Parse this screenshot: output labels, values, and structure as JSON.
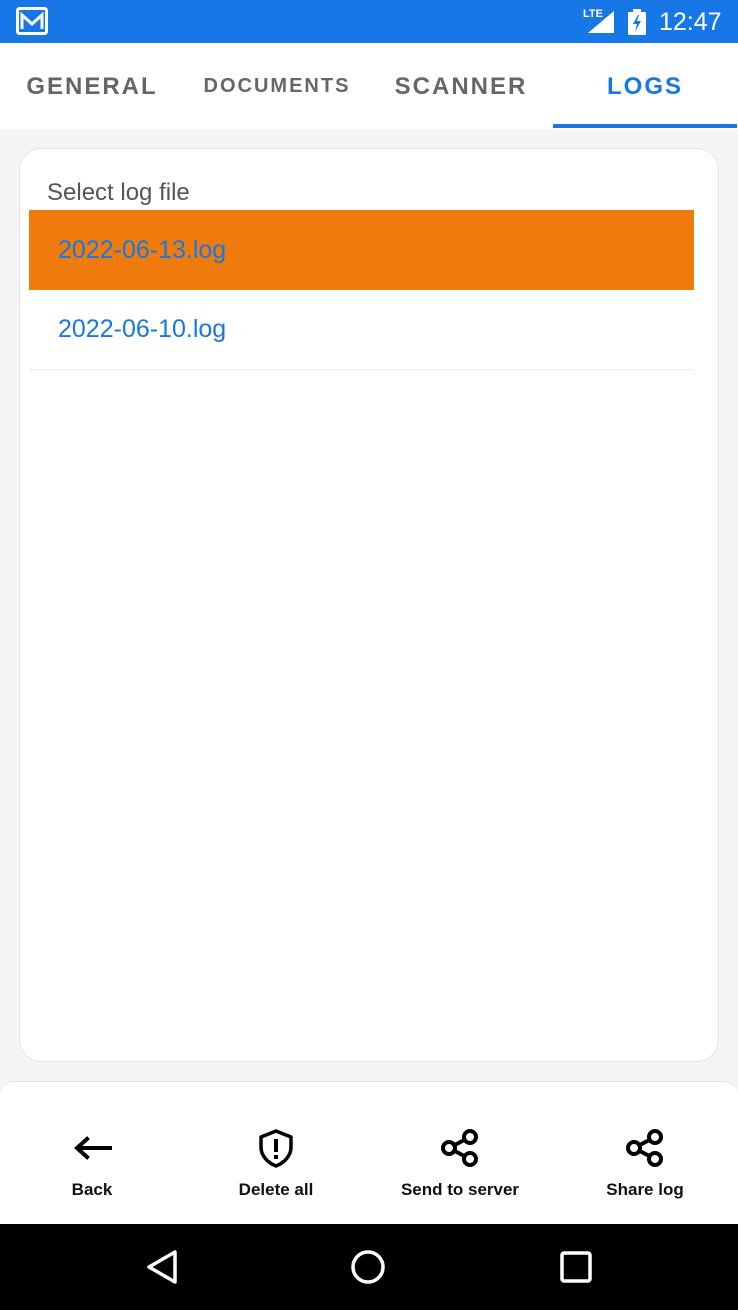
{
  "status_bar": {
    "network": "LTE",
    "time": "12:47"
  },
  "tabs": [
    {
      "label": "GENERAL",
      "active": false
    },
    {
      "label": "DOCUMENTS",
      "active": false
    },
    {
      "label": "SCANNER",
      "active": false
    },
    {
      "label": "LOGS",
      "active": true
    }
  ],
  "log_panel": {
    "title": "Select log file",
    "files": [
      {
        "name": "2022-06-13.log",
        "selected": true
      },
      {
        "name": "2022-06-10.log",
        "selected": false
      }
    ]
  },
  "actions": [
    {
      "label": "Back",
      "icon": "arrow-left-icon"
    },
    {
      "label": "Delete all",
      "icon": "shield-alert-icon"
    },
    {
      "label": "Send to server",
      "icon": "share-icon"
    },
    {
      "label": "Share log",
      "icon": "share-icon"
    }
  ],
  "colors": {
    "accent": "#1877e6",
    "selected": "#f07b0d"
  },
  "nav_bar": {
    "buttons": [
      "back-triangle-icon",
      "home-circle-icon",
      "recents-square-icon"
    ]
  }
}
